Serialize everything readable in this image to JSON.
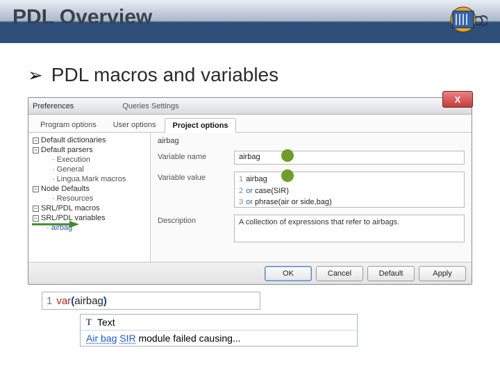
{
  "slide": {
    "title": "PDL Overview",
    "bullet_marker": "➢",
    "bullet_text": "PDL macros and variables"
  },
  "dialog": {
    "title_main": "Preferences",
    "title_secondary": "Queries  Settings",
    "close_label": "X",
    "tabs": {
      "program": "Program options",
      "user": "User options",
      "project": "Project options"
    },
    "tree": {
      "default_dictionaries": "Default dictionaries",
      "default_parsers": "Default parsers",
      "execution": "Execution",
      "general": "General",
      "lingua_mark_macros": "Lingua.Mark macros",
      "node_defaults": "Node Defaults",
      "resources": "Resources",
      "srl_pdl_macros": "SRL/PDL macros",
      "srl_pdl_variables": "SRL/PDL variables",
      "airbag": "airbag"
    },
    "form": {
      "heading": "airbag",
      "variable_name_label": "Variable name",
      "variable_name_value": "airbag",
      "variable_value_label": "Variable value",
      "value_lines": {
        "l1_no": "1",
        "l1_txt": "airbag",
        "l2_no": "2",
        "l2_or": "or",
        "l2_txt": " case(SIR)",
        "l3_no": "3",
        "l3_or": "or",
        "l3_txt": " phrase(air or side,bag)"
      },
      "description_label": "Description",
      "description_value": "A collection of expressions that refer to airbags."
    },
    "buttons": {
      "ok": "OK",
      "cancel": "Cancel",
      "default": "Default",
      "apply": "Apply"
    }
  },
  "snippet1": {
    "line_no": "1",
    "kw": "var",
    "open": "(",
    "arg": "airbag",
    "close": ")"
  },
  "snippet2": {
    "t_marker": "T",
    "t_label": "Text",
    "hl1": "Air bag",
    "hl2": "SIR",
    "rest": " module failed causing..."
  }
}
